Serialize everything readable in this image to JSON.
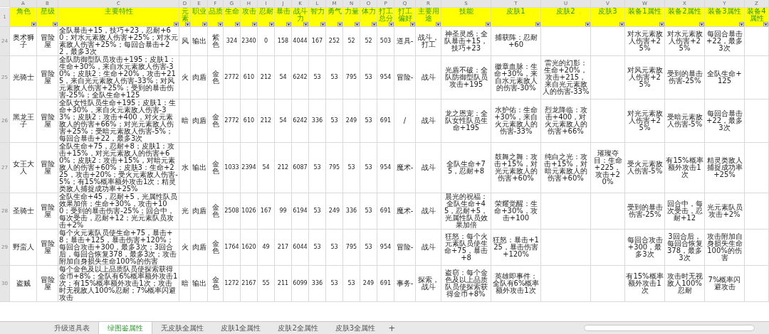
{
  "header_row_number": "1",
  "columns": [
    {
      "letter": "A",
      "header": "角色",
      "kind": "text"
    },
    {
      "letter": "B",
      "header": "星级",
      "kind": "text"
    },
    {
      "letter": "C",
      "header": "主要特性",
      "kind": "long"
    },
    {
      "letter": "D",
      "header": "元素",
      "kind": "text"
    },
    {
      "letter": "E",
      "header": "职业",
      "kind": "text"
    },
    {
      "letter": "F",
      "header": "品质",
      "kind": "text"
    },
    {
      "letter": "G",
      "header": "生命",
      "kind": "number"
    },
    {
      "letter": "H",
      "header": "攻击",
      "kind": "number"
    },
    {
      "letter": "I",
      "header": "忍耐",
      "kind": "number"
    },
    {
      "letter": "J",
      "header": "暴击",
      "kind": "number"
    },
    {
      "letter": "K",
      "header": "战斗力",
      "kind": "number"
    },
    {
      "letter": "L",
      "header": "智力",
      "kind": "number"
    },
    {
      "letter": "M",
      "header": "勇气",
      "kind": "number"
    },
    {
      "letter": "N",
      "header": "力量",
      "kind": "number"
    },
    {
      "letter": "O",
      "header": "体力",
      "kind": "number"
    },
    {
      "letter": "P",
      "header": "打工总分",
      "kind": "number"
    },
    {
      "letter": "Q",
      "header": "打工偏好",
      "kind": "text"
    },
    {
      "letter": "R",
      "header": "主要用途",
      "kind": "text"
    },
    {
      "letter": "S",
      "header": "技能",
      "kind": "text"
    },
    {
      "letter": "T",
      "header": "皮肤1",
      "kind": "text"
    },
    {
      "letter": "U",
      "header": "皮肤2",
      "kind": "text"
    },
    {
      "letter": "V",
      "header": "皮肤3",
      "kind": "text"
    },
    {
      "letter": "W",
      "header": "装备1属性",
      "kind": "text"
    },
    {
      "letter": "X",
      "header": "装备2属性",
      "kind": "text"
    },
    {
      "letter": "Y",
      "header": "装备3属性",
      "kind": "text"
    },
    {
      "letter": "Z",
      "header": "装备4属性"
    }
  ],
  "rows": [
    {
      "row_number": "24",
      "cells": [
        "奥术狮子",
        "冒险屋",
        "全队暴击+15，技巧+23，忍耐+60；对水元素敌人伤害+25%；对水元素敌人伤害+25%；每回合暴击+22，最多3次",
        "风",
        "输出",
        "紫色",
        "324",
        "2340",
        "0",
        "158",
        "4044",
        "167",
        "252",
        "52",
        "52",
        "503",
        "道具-",
        "战斗，打工",
        "神圣灵感：全队暴击+15，技巧+23",
        "捕获阵：忍耐+60",
        null,
        null,
        "对水元素敌人伤害+25%",
        "对水元素敌人伤害+25%",
        "每回合暴击+22，最多3次",
        null
      ]
    },
    {
      "row_number": "25",
      "cells": [
        "光骑士",
        "冒险屋",
        "全队防御型队员攻击+195；皮肤1：生命+30%，来自水元素敌人伤害-30%；皮肤2：生命+20%，攻击+215，来自光元素敌人伤害-33%；对风元素敌人伤害+25%；受到的暴击伤害-25%；全队生命+125",
        "火",
        "肉盾",
        "金色",
        "2772",
        "610",
        "212",
        "54",
        "6242",
        "53",
        "53",
        "795",
        "53",
        "954",
        "冒险-",
        "战斗",
        "光盾不破：全队防御型队员攻击+195",
        "徽章血脉：生命+30%，来自水元素敌人的伤害-30%",
        "雷光的幻影：生命+20%，攻击+215，来自光元素敌人的伤害-33%",
        null,
        "对风元素敌人伤害+25%",
        "受到的暴击伤害-25%",
        "全队生命+125",
        null
      ]
    },
    {
      "row_number": "26",
      "cells": [
        "黑龙王子",
        "冒险屋",
        "全队女性队员生命+195；皮肤1：生命+30%，来自火元素敌人伤害-33%；皮肤2：攻击+400，对火元素敌人的伤害+66%；对光元素敌人伤害+25%；受暗元素敌人伤害-5%；每回合暴击+22，最多3次",
        "暗",
        "肉盾",
        "金色",
        "2772",
        "610",
        "212",
        "54",
        "6242",
        "336",
        "53",
        "249",
        "53",
        "691",
        "/",
        "战斗",
        "龙之恩宠：全队女性队员生命+195",
        "水护佑：生命+30%，来自火元素敌人的伤害-33%",
        "烈龙降临：攻击+400，对火元素敌人的伤害+66%",
        null,
        "对光元素敌人伤害+25%",
        "受暗元素敌人伤害-5%",
        "每回合暴击+22，最多3次",
        null
      ]
    },
    {
      "row_number": "27",
      "cells": [
        "女王大人",
        "冒险屋",
        "全队生命+75，忍耐+8；皮肤1：攻击+15%，对光元素敌人的伤害+60%；皮肤2：攻击+15%，对暗元素敌人的伤害+60%；皮肤3：生命+225，攻击+20%；受火元素敌人伤害-5%；有15%概率额外攻击1次；精灵类敌人捕捉成功率+25%",
        "水",
        "输出",
        "金色",
        "1033",
        "2394",
        "54",
        "212",
        "6087",
        "53",
        "795",
        "53",
        "53",
        "954",
        "魔术-",
        "战斗",
        "全队生命+75，忍耐+8",
        "鼓舞之舞：攻击+15%，对光元素敌人的伤害+60%",
        "纯白之光：攻击+15%，对暗元素敌人的伤害+60%",
        "璀璨夺目：生命+225，攻击+20%",
        "受火元素敌人伤害-5%",
        "有15%概率额外攻击1次",
        "精灵类敌人捕捉成功率+25%",
        null
      ]
    },
    {
      "row_number": "28",
      "cells": [
        "圣骑士",
        "冒险屋",
        "全队生命+45，忍耐+5，光属性队员效果加倍；生命+30%，攻击+100；受到的暴击伤害-25%；回合中，每次受击，忍耐+12；光元素队员攻击+2%",
        "光",
        "肉盾",
        "金色",
        "2508",
        "1026",
        "167",
        "99",
        "6194",
        "53",
        "249",
        "336",
        "53",
        "691",
        "魔术-",
        "战斗",
        "晨光的祝福：全队生命+45，忍耐+5，光属性队员效果加倍",
        "荣耀觉醒：生命+30%，攻击+100",
        null,
        null,
        "受到的暴击伤害-25%",
        "回合中，每次受击，忍耐+12",
        "光元素队员攻击+2%",
        null
      ]
    },
    {
      "row_number": "29",
      "cells": [
        "野蛮人",
        "冒险屋",
        "每个火元素队员使生命+75，暴击+8；暴击+125，暴击伤害+120%；每回合攻击+300，最多3次；3回合后，每回合恢复378，最多3次；攻击附加自身损失生命100%的伤害",
        "火",
        "肉盾",
        "金色",
        "1764",
        "1620",
        "49",
        "217",
        "6044",
        "53",
        "53",
        "795",
        "53",
        "954",
        "冒险-",
        "战斗",
        "狂怒：每个火元素队员使生命+75，暴击+8",
        "狂怒：暴击+125，暴击伤害+120%",
        null,
        null,
        "每回合攻击+300，最多3次",
        "3回合后，每回合恢复378，最多3次",
        "攻击附加自身损失生命100%的伤害",
        null
      ]
    },
    {
      "row_number": "30",
      "cells": [
        "盗贼",
        "冒险屋",
        "每个金色及以上品质队员使探索获得金币+8%；全队有6%概率额外攻击1次；有15%概率额外攻击1次；攻击时无视敌人100%忍耐；7%概率闪避攻击",
        "暗",
        "输出",
        "金色",
        "1272",
        "2167",
        "55",
        "211",
        "6099",
        "336",
        "53",
        "53",
        "249",
        "691",
        "事务-",
        "探索，战斗",
        "盗窃：每个金色及以上品质队员使探索获得金币+8%",
        "英雄即事件：全队有6%概率额外攻击1次",
        null,
        null,
        "有15%概率额外攻击1次",
        "攻击时无视敌人100%忍耐",
        "7%概率闪避攻击",
        null
      ]
    }
  ],
  "sheet_tabs": [
    {
      "label": "升级道具表",
      "selected": false
    },
    {
      "label": "绿图鉴属性",
      "selected": true
    },
    {
      "label": "无皮肤全属性",
      "selected": false
    },
    {
      "label": "皮肤1全属性",
      "selected": false
    },
    {
      "label": "皮肤2全属性",
      "selected": false
    },
    {
      "label": "皮肤3全属性",
      "selected": false
    }
  ],
  "add_sheet_button": "+"
}
